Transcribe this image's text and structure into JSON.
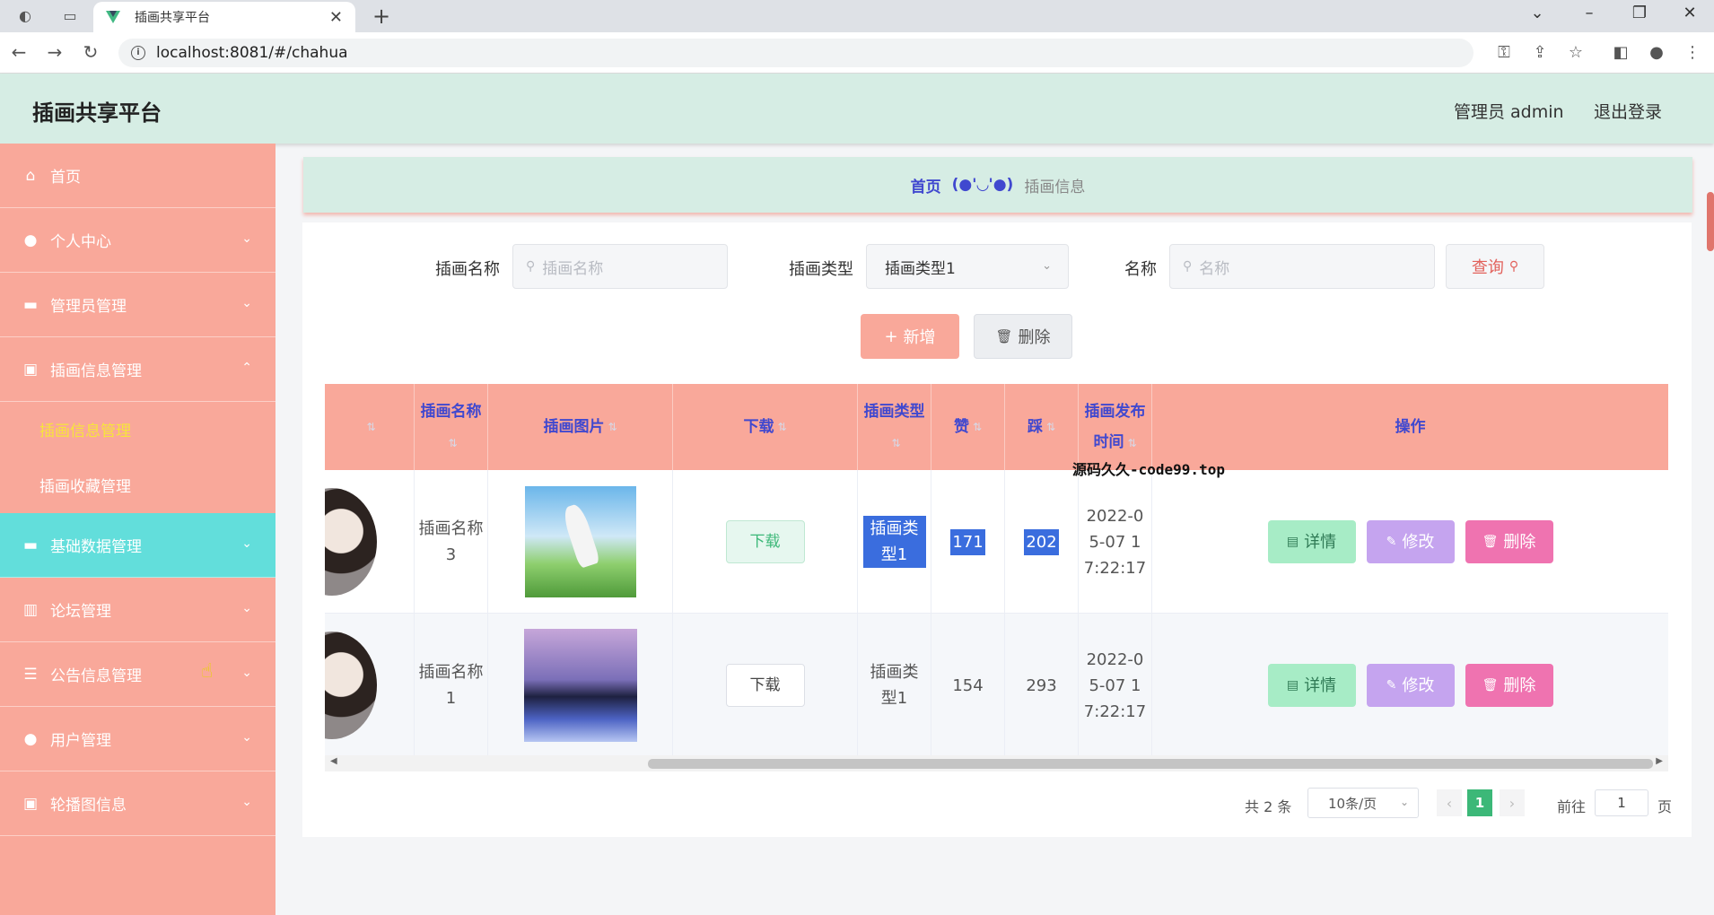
{
  "browser": {
    "tab_title": "插画共享平台",
    "url": "localhost:8081/#/chahua"
  },
  "header": {
    "title": "插画共享平台",
    "user_label": "管理员 admin",
    "logout": "退出登录"
  },
  "sidebar": {
    "items": [
      {
        "label": "首页",
        "icon": "home-icon"
      },
      {
        "label": "个人中心",
        "icon": "user-icon"
      },
      {
        "label": "管理员管理",
        "icon": "folder-icon"
      },
      {
        "label": "插画信息管理",
        "icon": "clipboard-icon"
      },
      {
        "label": "基础数据管理",
        "icon": "folder-icon"
      },
      {
        "label": "论坛管理",
        "icon": "bar-chart-icon"
      },
      {
        "label": "公告信息管理",
        "icon": "list-icon"
      },
      {
        "label": "用户管理",
        "icon": "user-icon"
      },
      {
        "label": "轮播图信息",
        "icon": "clipboard-icon"
      }
    ],
    "sub_items": [
      "插画信息管理",
      "插画收藏管理"
    ]
  },
  "breadcrumb": {
    "home": "首页",
    "face": "(●'◡'●)",
    "current": "插画信息"
  },
  "search": {
    "name_label": "插画名称",
    "name_placeholder": "插画名称",
    "type_label": "插画类型",
    "type_value": "插画类型1",
    "title_label": "名称",
    "title_placeholder": "名称",
    "query_button": "查询"
  },
  "actions": {
    "add": "新增",
    "delete": "删除"
  },
  "table": {
    "columns": [
      "插画名称",
      "插画图片",
      "下载",
      "插画类型",
      "赞",
      "踩",
      "插画发布时间",
      "操作"
    ],
    "rows": [
      {
        "name": "插画名称3",
        "download": "下载",
        "type": "插画类型1",
        "likes": "171",
        "dislikes": "202",
        "time": "2022-05-07 17:22:17"
      },
      {
        "name": "插画名称1",
        "download": "下载",
        "type": "插画类型1",
        "likes": "154",
        "dislikes": "293",
        "time": "2022-05-07 17:22:17"
      }
    ],
    "op_detail": "详情",
    "op_edit": "修改",
    "op_delete": "删除",
    "overlay_text": "源码久久-code99.top"
  },
  "pagination": {
    "total": "共 2 条",
    "page_size": "10条/页",
    "current_page": "1",
    "goto_label": "前往",
    "goto_value": "1",
    "page_suffix": "页"
  },
  "colors": {
    "sidebar_bg": "#f9a89a",
    "header_bg": "#d6ede4",
    "accent_blue": "#4048cf",
    "active_menu": "#62dedb",
    "page_active": "#3cb878"
  }
}
